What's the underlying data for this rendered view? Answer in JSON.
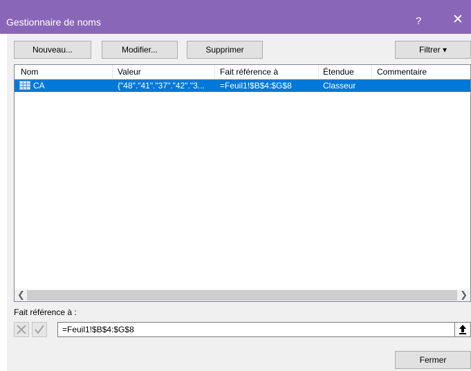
{
  "window": {
    "title": "Gestionnaire de noms",
    "help_label": "?",
    "close_label": "✕"
  },
  "toolbar": {
    "new_label": "Nouveau...",
    "modify_label": "Modifier...",
    "delete_label": "Supprimer",
    "filter_label": "Filtrer ▾"
  },
  "table": {
    "headers": [
      "Nom",
      "Valeur",
      "Fait référence à",
      "Étendue",
      "Commentaire"
    ],
    "rows": [
      {
        "nom": "CA",
        "valeur": "{\"48\".\"41\".\"37\".\"42\".\"3...",
        "reference": "=Feuil1!$B$4:$G$8",
        "etendue": "Classeur",
        "commentaire": "",
        "icon": "named-range-icon"
      }
    ]
  },
  "reference_section": {
    "label": "Fait référence à :",
    "value": "=Feuil1!$B$4:$G$8"
  },
  "footer": {
    "close_label": "Fermer"
  },
  "colors": {
    "titlebar": "#8a66b8",
    "selection": "#0078d7"
  }
}
